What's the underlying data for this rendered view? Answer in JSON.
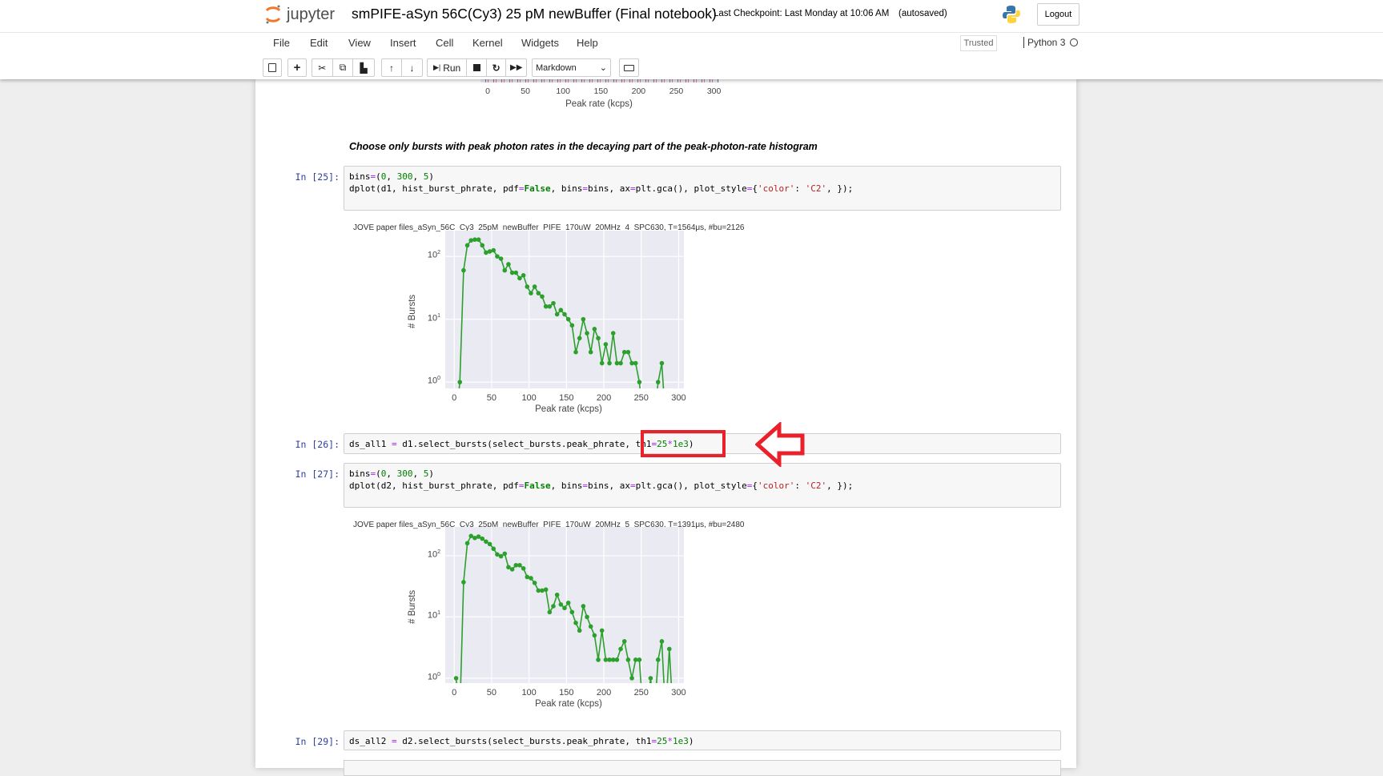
{
  "header": {
    "logo_text": "jupyter",
    "notebook_title": "smPIFE-aSyn 56C(Cy3) 25 pM newBuffer (Final notebook)",
    "checkpoint": "Last Checkpoint: Last Monday at 10:06 AM",
    "autosave": "(autosaved)",
    "logout": "Logout"
  },
  "menu": {
    "items": [
      "File",
      "Edit",
      "View",
      "Insert",
      "Cell",
      "Kernel",
      "Widgets",
      "Help"
    ],
    "trusted": "Trusted",
    "kernel": "Python 3"
  },
  "toolbar": {
    "run": "Run",
    "cell_type": "Markdown"
  },
  "top_plot": {
    "xticks": [
      "0",
      "50",
      "100",
      "150",
      "200",
      "250",
      "300"
    ],
    "xlabel": "Peak rate (kcps)",
    "ytick_partial": "10"
  },
  "markdown": "Choose only bursts with peak photon rates in the decaying part of the peak-photon-rate histogram",
  "cells": [
    {
      "prompt": "In [25]:",
      "lines": [
        [
          [
            "bins",
            ""
          ],
          [
            "=",
            "o"
          ],
          [
            "(",
            ""
          ],
          [
            "0",
            "n"
          ],
          [
            ", ",
            ""
          ],
          [
            "300",
            "n"
          ],
          [
            ", ",
            ""
          ],
          [
            "5",
            "n"
          ],
          [
            ")",
            ""
          ]
        ],
        [
          [
            "dplot(d1, hist_burst_phrate, pdf",
            ""
          ],
          [
            "=",
            "o"
          ],
          [
            "False",
            "k"
          ],
          [
            ", bins",
            ""
          ],
          [
            "=",
            "o"
          ],
          [
            "bins, ax",
            ""
          ],
          [
            "=",
            "o"
          ],
          [
            "plt.gca(), plot_style",
            ""
          ],
          [
            "=",
            "o"
          ],
          [
            "{",
            ""
          ],
          [
            "'color'",
            "s"
          ],
          [
            ": ",
            ""
          ],
          [
            "'C2'",
            "s"
          ],
          [
            ", });",
            ""
          ]
        ]
      ]
    },
    {
      "prompt": "In [26]:",
      "lines": [
        [
          [
            "ds_all1 ",
            ""
          ],
          [
            "=",
            "o"
          ],
          [
            " d1.select_bursts(select_bursts.peak_phrate, th1",
            ""
          ],
          [
            "=",
            "o"
          ],
          [
            "25",
            "n"
          ],
          [
            "*",
            "o"
          ],
          [
            "1e3",
            "n"
          ],
          [
            ")",
            ""
          ]
        ]
      ]
    },
    {
      "prompt": "In [27]:",
      "lines": [
        [
          [
            "bins",
            ""
          ],
          [
            "=",
            "o"
          ],
          [
            "(",
            ""
          ],
          [
            "0",
            "n"
          ],
          [
            ", ",
            ""
          ],
          [
            "300",
            "n"
          ],
          [
            ", ",
            ""
          ],
          [
            "5",
            "n"
          ],
          [
            ")",
            ""
          ]
        ],
        [
          [
            "dplot(d2, hist_burst_phrate, pdf",
            ""
          ],
          [
            "=",
            "o"
          ],
          [
            "False",
            "k"
          ],
          [
            ", bins",
            ""
          ],
          [
            "=",
            "o"
          ],
          [
            "bins, ax",
            ""
          ],
          [
            "=",
            "o"
          ],
          [
            "plt.gca(), plot_style",
            ""
          ],
          [
            "=",
            "o"
          ],
          [
            "{",
            ""
          ],
          [
            "'color'",
            "s"
          ],
          [
            ": ",
            ""
          ],
          [
            "'C2'",
            "s"
          ],
          [
            ", });",
            ""
          ]
        ]
      ]
    },
    {
      "prompt": "In [29]:",
      "lines": [
        [
          [
            "ds_all2 ",
            ""
          ],
          [
            "=",
            "o"
          ],
          [
            " d2.select_bursts(select_bursts.peak_phrate, th1",
            ""
          ],
          [
            "=",
            "o"
          ],
          [
            "25",
            "n"
          ],
          [
            "*",
            "o"
          ],
          [
            "1e3",
            "n"
          ],
          [
            ")",
            ""
          ]
        ]
      ]
    }
  ],
  "colors": {
    "line": "#2ca02c",
    "axes_bg": "#eaeaf2",
    "highlight": "#e8212b"
  },
  "chart_data": [
    {
      "type": "line",
      "title": "JOVE paper files_aSyn_56C_Cy3_25pM_newBuffer_PIFE_170uW_20MHz_4_SPC630, T=1564μs, #bu=2126",
      "xlabel": "Peak rate (kcps)",
      "ylabel": "# Bursts",
      "yscale": "log",
      "xlim": [
        -12,
        307
      ],
      "ylim_log10": [
        -0.1,
        2.41
      ],
      "xticks": [
        "0",
        "50",
        "100",
        "150",
        "200",
        "250",
        "300"
      ],
      "yticks": [
        {
          "base": "10",
          "exp": "0"
        },
        {
          "base": "10",
          "exp": "1"
        },
        {
          "base": "10",
          "exp": "2"
        }
      ],
      "x": [
        2.5,
        7.5,
        12.5,
        17.5,
        22.5,
        27.5,
        32.5,
        37.5,
        42.5,
        47.5,
        52.5,
        57.5,
        62.5,
        67.5,
        72.5,
        77.5,
        82.5,
        87.5,
        92.5,
        97.5,
        102.5,
        107.5,
        112.5,
        117.5,
        122.5,
        127.5,
        132.5,
        137.5,
        142.5,
        147.5,
        152.5,
        157.5,
        162.5,
        167.5,
        172.5,
        177.5,
        182.5,
        187.5,
        192.5,
        197.5,
        202.5,
        207.5,
        212.5,
        217.5,
        222.5,
        227.5,
        232.5,
        237.5,
        242.5,
        247.5,
        252.5,
        257.5,
        262.5,
        267.5,
        272.5,
        277.5,
        282.5
      ],
      "y": [
        0,
        1,
        60,
        150,
        180,
        185,
        185,
        150,
        115,
        120,
        125,
        100,
        92,
        60,
        75,
        55,
        55,
        45,
        50,
        33,
        26,
        33,
        26,
        23,
        16,
        16,
        18,
        12,
        14,
        12,
        10,
        8,
        3,
        5,
        10,
        6,
        3,
        7,
        5,
        2,
        4,
        2,
        6,
        2,
        2,
        3,
        3,
        2,
        2,
        1,
        0,
        0,
        0,
        0,
        1,
        2,
        0
      ]
    },
    {
      "type": "line",
      "title": "JOVE paper files_aSyn_56C_Cy3_25pM_newBuffer_PIFE_170uW_20MHz_5_SPC630, T=1391μs, #bu=2480",
      "xlabel": "Peak rate (kcps)",
      "ylabel": "# Bursts",
      "yscale": "log",
      "xlim": [
        -12,
        307
      ],
      "ylim_log10": [
        -0.08,
        2.47
      ],
      "xticks": [
        "0",
        "50",
        "100",
        "150",
        "200",
        "250",
        "300"
      ],
      "yticks": [
        {
          "base": "10",
          "exp": "0"
        },
        {
          "base": "10",
          "exp": "1"
        },
        {
          "base": "10",
          "exp": "2"
        }
      ],
      "x": [
        2.5,
        7.5,
        12.5,
        17.5,
        22.5,
        27.5,
        32.5,
        37.5,
        42.5,
        47.5,
        52.5,
        57.5,
        62.5,
        67.5,
        72.5,
        77.5,
        82.5,
        87.5,
        92.5,
        97.5,
        102.5,
        107.5,
        112.5,
        117.5,
        122.5,
        127.5,
        132.5,
        137.5,
        142.5,
        147.5,
        152.5,
        157.5,
        162.5,
        167.5,
        172.5,
        177.5,
        182.5,
        187.5,
        192.5,
        197.5,
        202.5,
        207.5,
        212.5,
        217.5,
        222.5,
        227.5,
        232.5,
        237.5,
        242.5,
        247.5,
        252.5,
        257.5,
        262.5,
        267.5,
        272.5,
        277.5,
        282.5,
        287.5,
        292.5
      ],
      "y": [
        1,
        0,
        37,
        160,
        210,
        195,
        205,
        190,
        170,
        155,
        130,
        105,
        98,
        108,
        65,
        60,
        70,
        70,
        62,
        45,
        43,
        36,
        27,
        27,
        28,
        12,
        15,
        23,
        16,
        14,
        17,
        12,
        8,
        6,
        15,
        10,
        7,
        5,
        2,
        6,
        2,
        2,
        2,
        2,
        3,
        4,
        2,
        1,
        2,
        2,
        0,
        0,
        1,
        0,
        2,
        4,
        0,
        3,
        0
      ]
    }
  ]
}
